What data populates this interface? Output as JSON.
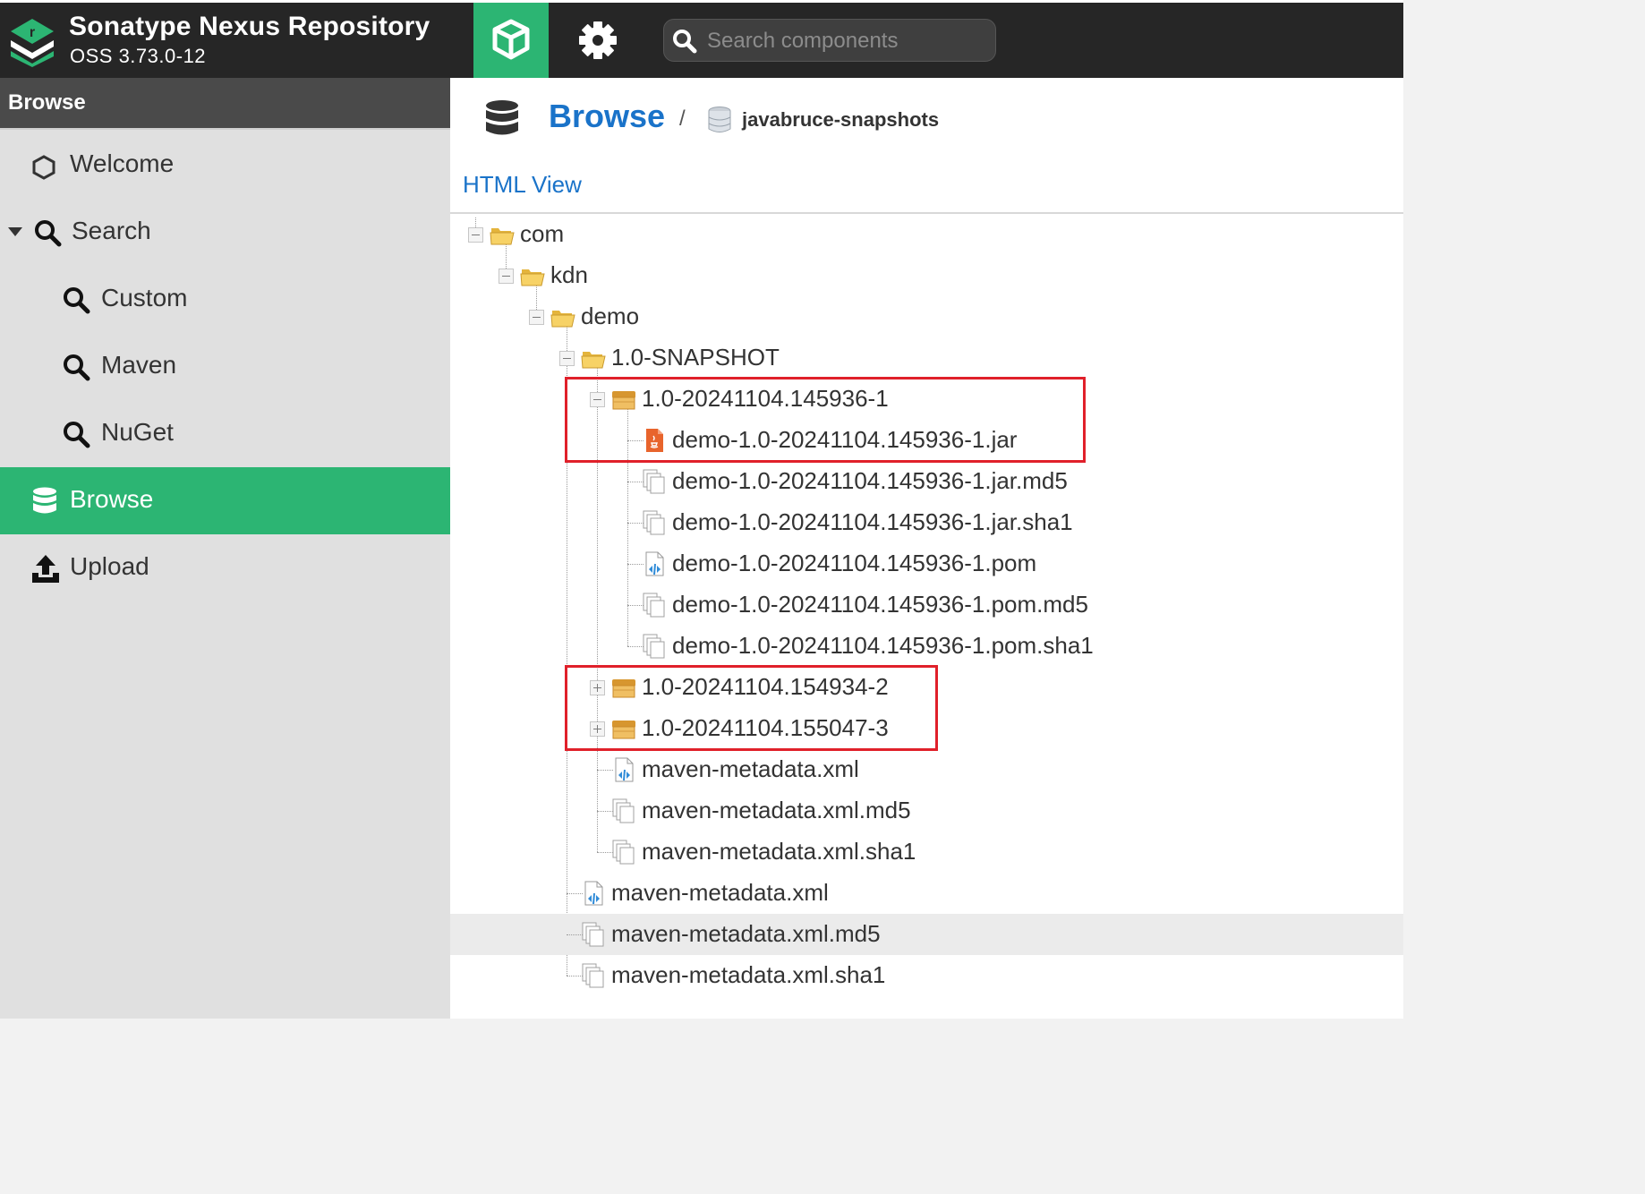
{
  "app": {
    "name": "Sonatype Nexus Repository",
    "version": "OSS 3.73.0-12"
  },
  "header": {
    "search_placeholder": "Search components",
    "browse_mode_icon": "cube-icon",
    "admin_mode_icon": "gear-icon"
  },
  "sidebar": {
    "title": "Browse",
    "items": [
      {
        "label": "Welcome",
        "icon": "hexagon-icon"
      },
      {
        "label": "Search",
        "icon": "search-icon",
        "expanded": true
      },
      {
        "label": "Custom",
        "icon": "search-icon"
      },
      {
        "label": "Maven",
        "icon": "search-icon"
      },
      {
        "label": "NuGet",
        "icon": "search-icon"
      },
      {
        "label": "Browse",
        "icon": "database-icon",
        "active": true
      },
      {
        "label": "Upload",
        "icon": "upload-icon"
      }
    ]
  },
  "breadcrumb": {
    "root": "Browse",
    "separator": "/",
    "repository": "javabruce-snapshots"
  },
  "html_view_link": "HTML View",
  "tree": [
    {
      "label": "com",
      "type": "folder",
      "depth": 0,
      "toggle": "minus"
    },
    {
      "label": "kdn",
      "type": "folder",
      "depth": 1,
      "toggle": "minus"
    },
    {
      "label": "demo",
      "type": "folder",
      "depth": 2,
      "toggle": "minus"
    },
    {
      "label": "1.0-SNAPSHOT",
      "type": "folder",
      "depth": 3,
      "toggle": "minus"
    },
    {
      "label": "1.0-20241104.145936-1",
      "type": "component",
      "depth": 4,
      "toggle": "minus",
      "highlighted": true
    },
    {
      "label": "demo-1.0-20241104.145936-1.jar",
      "type": "jar",
      "depth": 5,
      "highlighted": true
    },
    {
      "label": "demo-1.0-20241104.145936-1.jar.md5",
      "type": "file",
      "depth": 5
    },
    {
      "label": "demo-1.0-20241104.145936-1.jar.sha1",
      "type": "file",
      "depth": 5
    },
    {
      "label": "demo-1.0-20241104.145936-1.pom",
      "type": "xml",
      "depth": 5
    },
    {
      "label": "demo-1.0-20241104.145936-1.pom.md5",
      "type": "file",
      "depth": 5
    },
    {
      "label": "demo-1.0-20241104.145936-1.pom.sha1",
      "type": "file",
      "depth": 5
    },
    {
      "label": "1.0-20241104.154934-2",
      "type": "component",
      "depth": 4,
      "toggle": "plus",
      "highlighted": true
    },
    {
      "label": "1.0-20241104.155047-3",
      "type": "component",
      "depth": 4,
      "toggle": "plus",
      "highlighted": true
    },
    {
      "label": "maven-metadata.xml",
      "type": "xml",
      "depth": 4
    },
    {
      "label": "maven-metadata.xml.md5",
      "type": "file",
      "depth": 4
    },
    {
      "label": "maven-metadata.xml.sha1",
      "type": "file",
      "depth": 4
    },
    {
      "label": "maven-metadata.xml",
      "type": "xml",
      "depth": 3
    },
    {
      "label": "maven-metadata.xml.md5",
      "type": "file",
      "depth": 3,
      "selected": true
    },
    {
      "label": "maven-metadata.xml.sha1",
      "type": "file",
      "depth": 3
    }
  ],
  "colors": {
    "topbar": "#262626",
    "accent_green": "#2cb573",
    "link_blue": "#1a73c9",
    "highlight_red": "#e0202a",
    "folder_yellow": "#f5c94c",
    "component_tan": "#e2a94a",
    "jar_orange": "#e8642c"
  }
}
